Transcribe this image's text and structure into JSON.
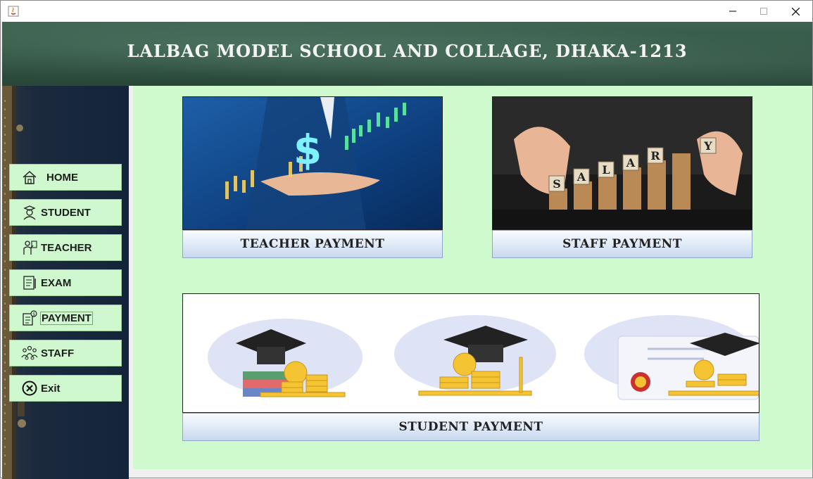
{
  "header": {
    "title": "LALBAG MODEL SCHOOL AND COLLAGE, DHAKA-1213"
  },
  "sidebar": {
    "items": [
      {
        "label": "HOME",
        "icon": "home-icon"
      },
      {
        "label": "STUDENT",
        "icon": "student-icon"
      },
      {
        "label": "TEACHER",
        "icon": "teacher-icon"
      },
      {
        "label": "EXAM",
        "icon": "exam-icon"
      },
      {
        "label": "PAYMENT",
        "icon": "payment-icon"
      },
      {
        "label": "STAFF",
        "icon": "staff-icon"
      },
      {
        "label": "Exit",
        "icon": "exit-icon"
      }
    ],
    "active": "PAYMENT"
  },
  "cards": {
    "teacher_payment": "TEACHER PAYMENT",
    "staff_payment": "STAFF PAYMENT",
    "student_payment": "STUDENT PAYMENT"
  },
  "salary_tiles": [
    "S",
    "A",
    "L",
    "A",
    "R",
    "Y"
  ],
  "colors": {
    "content_bg": "#cffacd",
    "nav_button": "#cff8cf",
    "banner": "#2f5141"
  }
}
